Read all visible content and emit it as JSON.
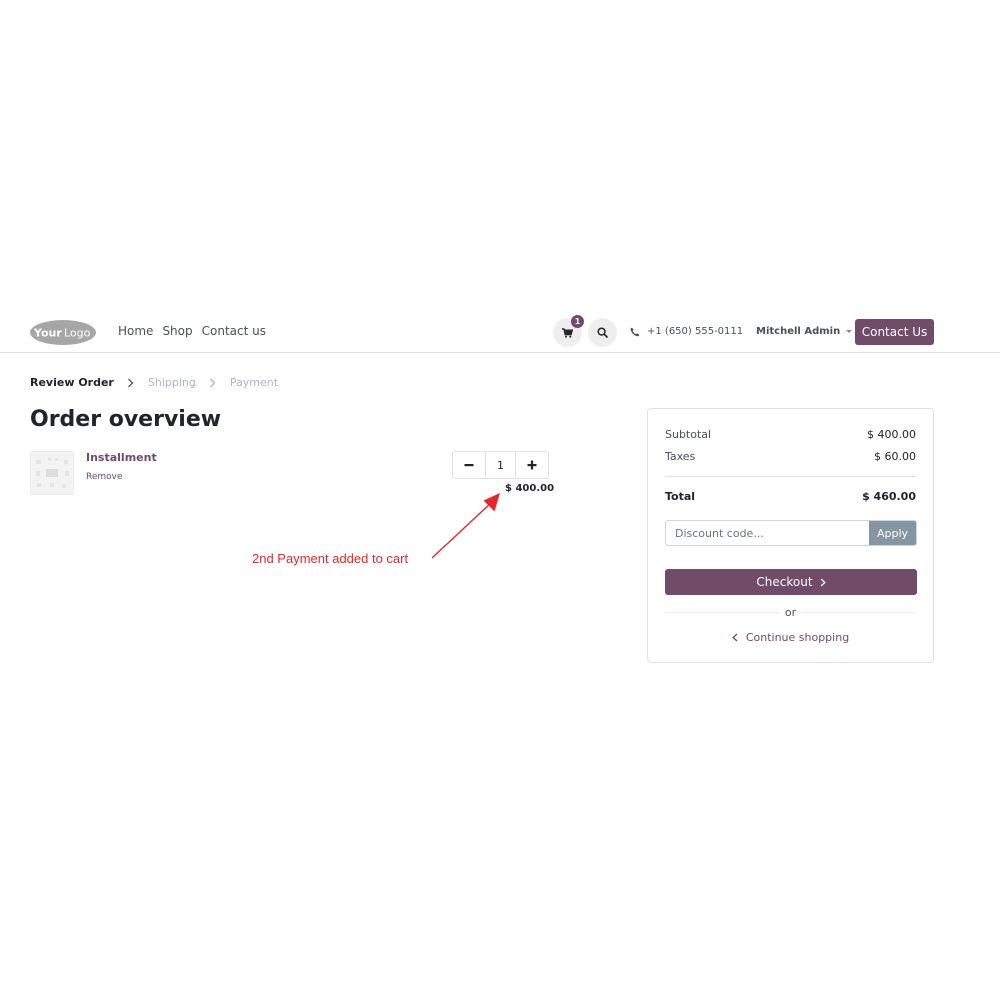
{
  "header": {
    "logo_text": "YourLogo",
    "nav": [
      "Home",
      "Shop",
      "Contact us"
    ],
    "cart_count": "1",
    "phone": "+1 (650) 555-0111",
    "user_name": "Mitchell Admin",
    "contact_button": "Contact Us"
  },
  "breadcrumb": {
    "steps": [
      "Review Order",
      "Shipping",
      "Payment"
    ],
    "active_index": 0
  },
  "page_title": "Order overview",
  "cart": {
    "lines": [
      {
        "name": "Installment",
        "remove_label": "Remove",
        "quantity": "1",
        "price": "$ 400.00",
        "decrease_icon": "minus-icon",
        "increase_icon": "plus-icon"
      }
    ]
  },
  "annotation": {
    "text": "2nd Payment added to cart",
    "color": "#e8262a"
  },
  "summary": {
    "subtotal_label": "Subtotal",
    "subtotal": "$ 400.00",
    "taxes_label": "Taxes",
    "taxes": "$ 60.00",
    "total_label": "Total",
    "total": "$ 460.00",
    "discount_placeholder": "Discount code...",
    "apply_label": "Apply",
    "checkout_label": "Checkout",
    "or_label": "or",
    "continue_label": "Continue shopping"
  },
  "colors": {
    "brand": "#714b67",
    "apply_button": "#8595a2",
    "annotation": "#e8262a"
  },
  "icons": [
    "cart-icon",
    "search-icon",
    "phone-icon",
    "caret-down-icon",
    "chevron-right-icon",
    "chevron-left-icon",
    "minus-icon",
    "plus-icon"
  ]
}
